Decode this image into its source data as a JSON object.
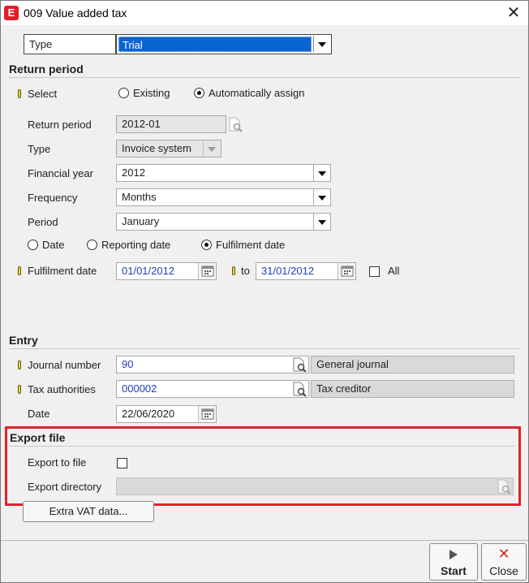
{
  "window": {
    "title": "009 Value added tax",
    "app_icon": "E"
  },
  "type_row": {
    "label": "Type",
    "value": "Trial"
  },
  "return_period_section": {
    "title": "Return period",
    "select_label": "Select",
    "radio_existing": "Existing",
    "radio_auto": "Automatically assign",
    "selected": "Automatically assign",
    "return_period_label": "Return period",
    "return_period_value": "2012-01",
    "type_label": "Type",
    "type_value": "Invoice system",
    "financial_year_label": "Financial year",
    "financial_year_value": "2012",
    "frequency_label": "Frequency",
    "frequency_value": "Months",
    "period_label": "Period",
    "period_value": "January",
    "date_mode_options": [
      "Date",
      "Reporting date",
      "Fulfilment date"
    ],
    "date_mode_selected": "Fulfilment date",
    "fulfilment_label": "Fulfilment date",
    "fulfilment_from": "01/01/2012",
    "to_label": "to",
    "fulfilment_to": "31/01/2012",
    "all_label": "All",
    "all_checked": false
  },
  "entry_section": {
    "title": "Entry",
    "journal_label": "Journal number",
    "journal_value": "90",
    "journal_desc": "General journal",
    "tax_label": "Tax authorities",
    "tax_value": "000002",
    "tax_desc": "Tax creditor",
    "date_label": "Date",
    "date_value": "22/06/2020"
  },
  "export_section": {
    "title": "Export file",
    "export_to_file_label": "Export to file",
    "export_to_file_checked": false,
    "export_directory_label": "Export directory",
    "export_directory_value": ""
  },
  "buttons": {
    "extra_vat": "Extra VAT data...",
    "start": "Start",
    "close": "Close"
  },
  "colors": {
    "selection_blue": "#0a64d2",
    "highlight_red": "#e3202a",
    "required_marker": "#e8d44a",
    "close_red": "#d7262b"
  },
  "icons": {
    "lookup": "magnifier-page-icon",
    "calendar": "calendar-icon",
    "start": "play-triangle-icon",
    "close": "red-x-icon"
  }
}
